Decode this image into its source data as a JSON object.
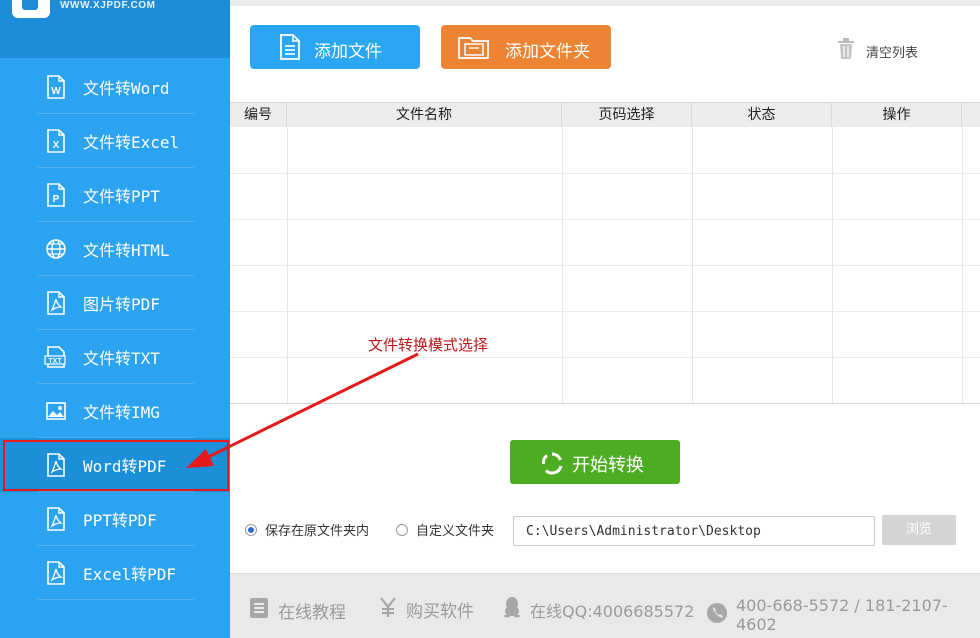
{
  "sidebar": {
    "site_url": "WWW.XJPDF.COM",
    "items": [
      {
        "label": "文件转Word",
        "icon": "word-icon"
      },
      {
        "label": "文件转Excel",
        "icon": "excel-icon"
      },
      {
        "label": "文件转PPT",
        "icon": "ppt-icon"
      },
      {
        "label": "文件转HTML",
        "icon": "globe-icon"
      },
      {
        "label": "图片转PDF",
        "icon": "pdf-icon"
      },
      {
        "label": "文件转TXT",
        "icon": "txt-icon"
      },
      {
        "label": "文件转IMG",
        "icon": "image-icon"
      },
      {
        "label": "Word转PDF",
        "icon": "pdf-icon",
        "active": true
      },
      {
        "label": "PPT转PDF",
        "icon": "pdf-icon"
      },
      {
        "label": "Excel转PDF",
        "icon": "pdf-icon"
      }
    ]
  },
  "toolbar": {
    "add_file_label": "添加文件",
    "add_folder_label": "添加文件夹",
    "clear_list_label": "清空列表"
  },
  "table": {
    "columns": [
      "编号",
      "文件名称",
      "页码选择",
      "状态",
      "操作"
    ],
    "rows": []
  },
  "annotation": {
    "text": "文件转换模式选择"
  },
  "start_button_label": "开始转换",
  "save_options": {
    "original_folder_label": "保存在原文件夹内",
    "custom_folder_label": "自定义文件夹",
    "selected": "original_folder",
    "path_value": "C:\\Users\\Administrator\\Desktop",
    "browse_label": "浏览"
  },
  "footer": {
    "tutorial_label": "在线教程",
    "buy_label": "购买软件",
    "qq_label": "在线QQ:4006685572",
    "phone_label": "400-668-5572 / 181-2107-4602"
  },
  "colors": {
    "sidebar_bg": "#2ba3f1",
    "active_item_bg": "#1d8ed8",
    "highlight_border": "#e8191b",
    "add_file_btn": "#2ba6f3",
    "add_folder_btn": "#ec8433",
    "start_btn": "#4bad1f",
    "annotation": "#c0161a"
  }
}
